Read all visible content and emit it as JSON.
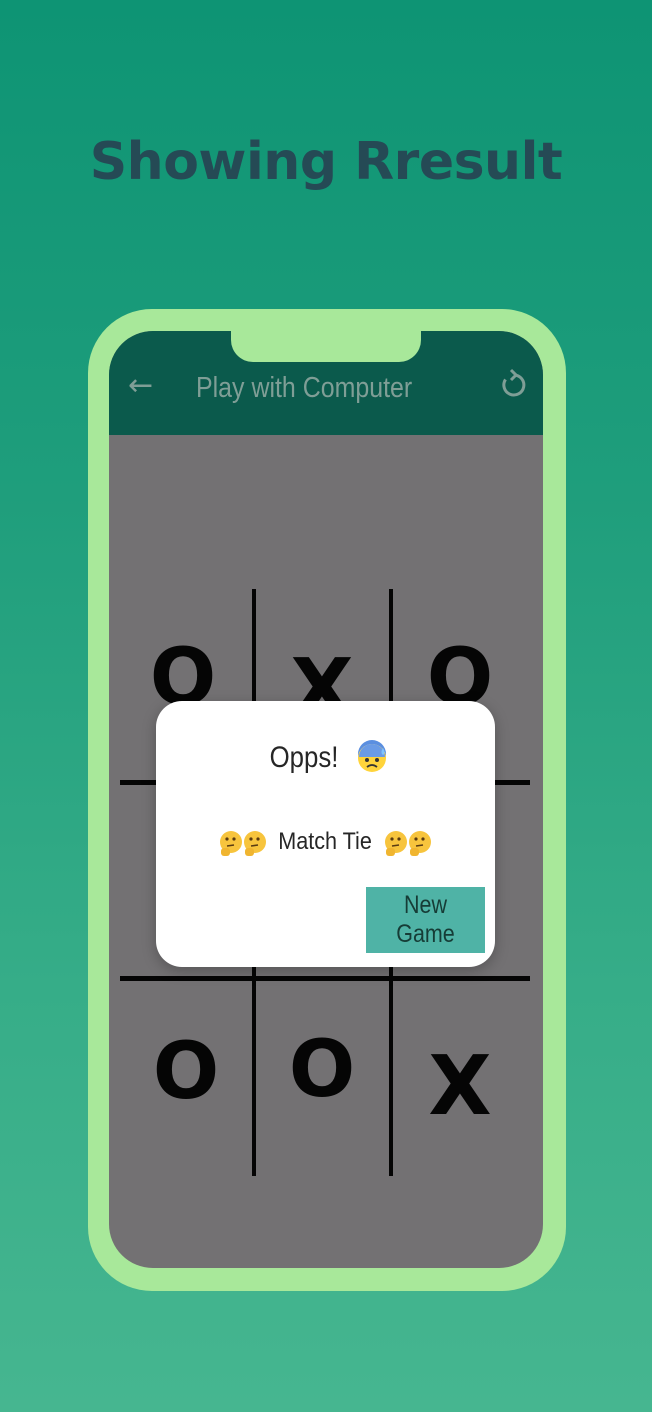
{
  "headline": "Showing Rresult",
  "app": {
    "title": "Play with Computer",
    "back_icon": "arrow-left-icon",
    "reload_icon": "refresh-icon"
  },
  "board": {
    "cells": [
      "O",
      "X",
      "O",
      "",
      "",
      "",
      "O",
      "O",
      "X"
    ]
  },
  "dialog": {
    "title": "Opps!",
    "title_emoji": "cold-sweat-face-icon",
    "message": "Match Tie",
    "message_emoji": "thinking-face-icon",
    "button_label": "New Game"
  },
  "colors": {
    "background_top": "#0e9474",
    "background_bottom": "#46b690",
    "headline": "#254a55",
    "phone_frame": "#a8e89a",
    "app_bar": "#0b5a4c",
    "screen_dim": "#737173",
    "button": "#4fb3a6"
  }
}
